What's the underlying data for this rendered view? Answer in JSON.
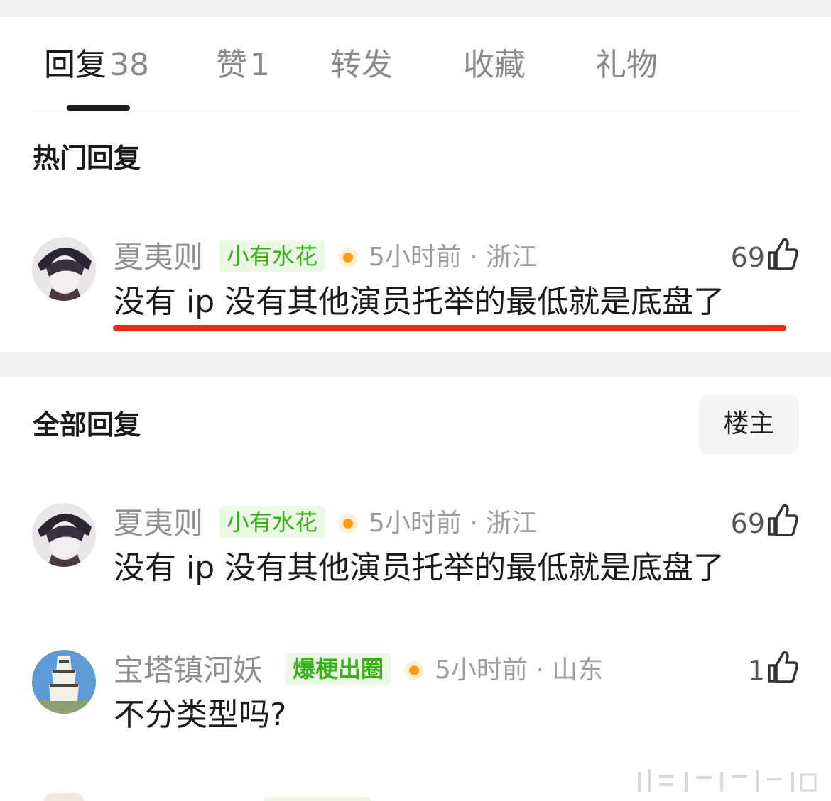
{
  "tabs": [
    {
      "label": "回复",
      "count": "38"
    },
    {
      "label": "赞",
      "count": "1"
    },
    {
      "label": "转发"
    },
    {
      "label": "收藏"
    },
    {
      "label": "礼物"
    }
  ],
  "hot_section": {
    "title": "热门回复"
  },
  "all_section": {
    "title": "全部回复",
    "filter_button": "楼主"
  },
  "hot_comment": {
    "user": "夏夷则",
    "badge": "小有水花",
    "time": "5小时前",
    "location": "浙江",
    "likes": "69",
    "text": "没有 ip 没有其他演员托举的最低就是底盘了"
  },
  "comments": [
    {
      "user": "夏夷则",
      "badge": "小有水花",
      "time": "5小时前",
      "location": "浙江",
      "likes": "69",
      "text": "没有 ip 没有其他演员托举的最低就是底盘了"
    },
    {
      "user": "宝塔镇河妖",
      "badge": "爆梗出圈",
      "time": "5小时前",
      "location": "山东",
      "likes": "1",
      "text": "不分类型吗?"
    }
  ],
  "icons": {
    "like": "thumbs-up-icon",
    "dot": "orange-dot-icon"
  },
  "colors": {
    "badge_text": "#38b01a",
    "badge_bg": "#eaf8e4",
    "dot": "#ff9f10",
    "highlight": "#e12c1a"
  }
}
